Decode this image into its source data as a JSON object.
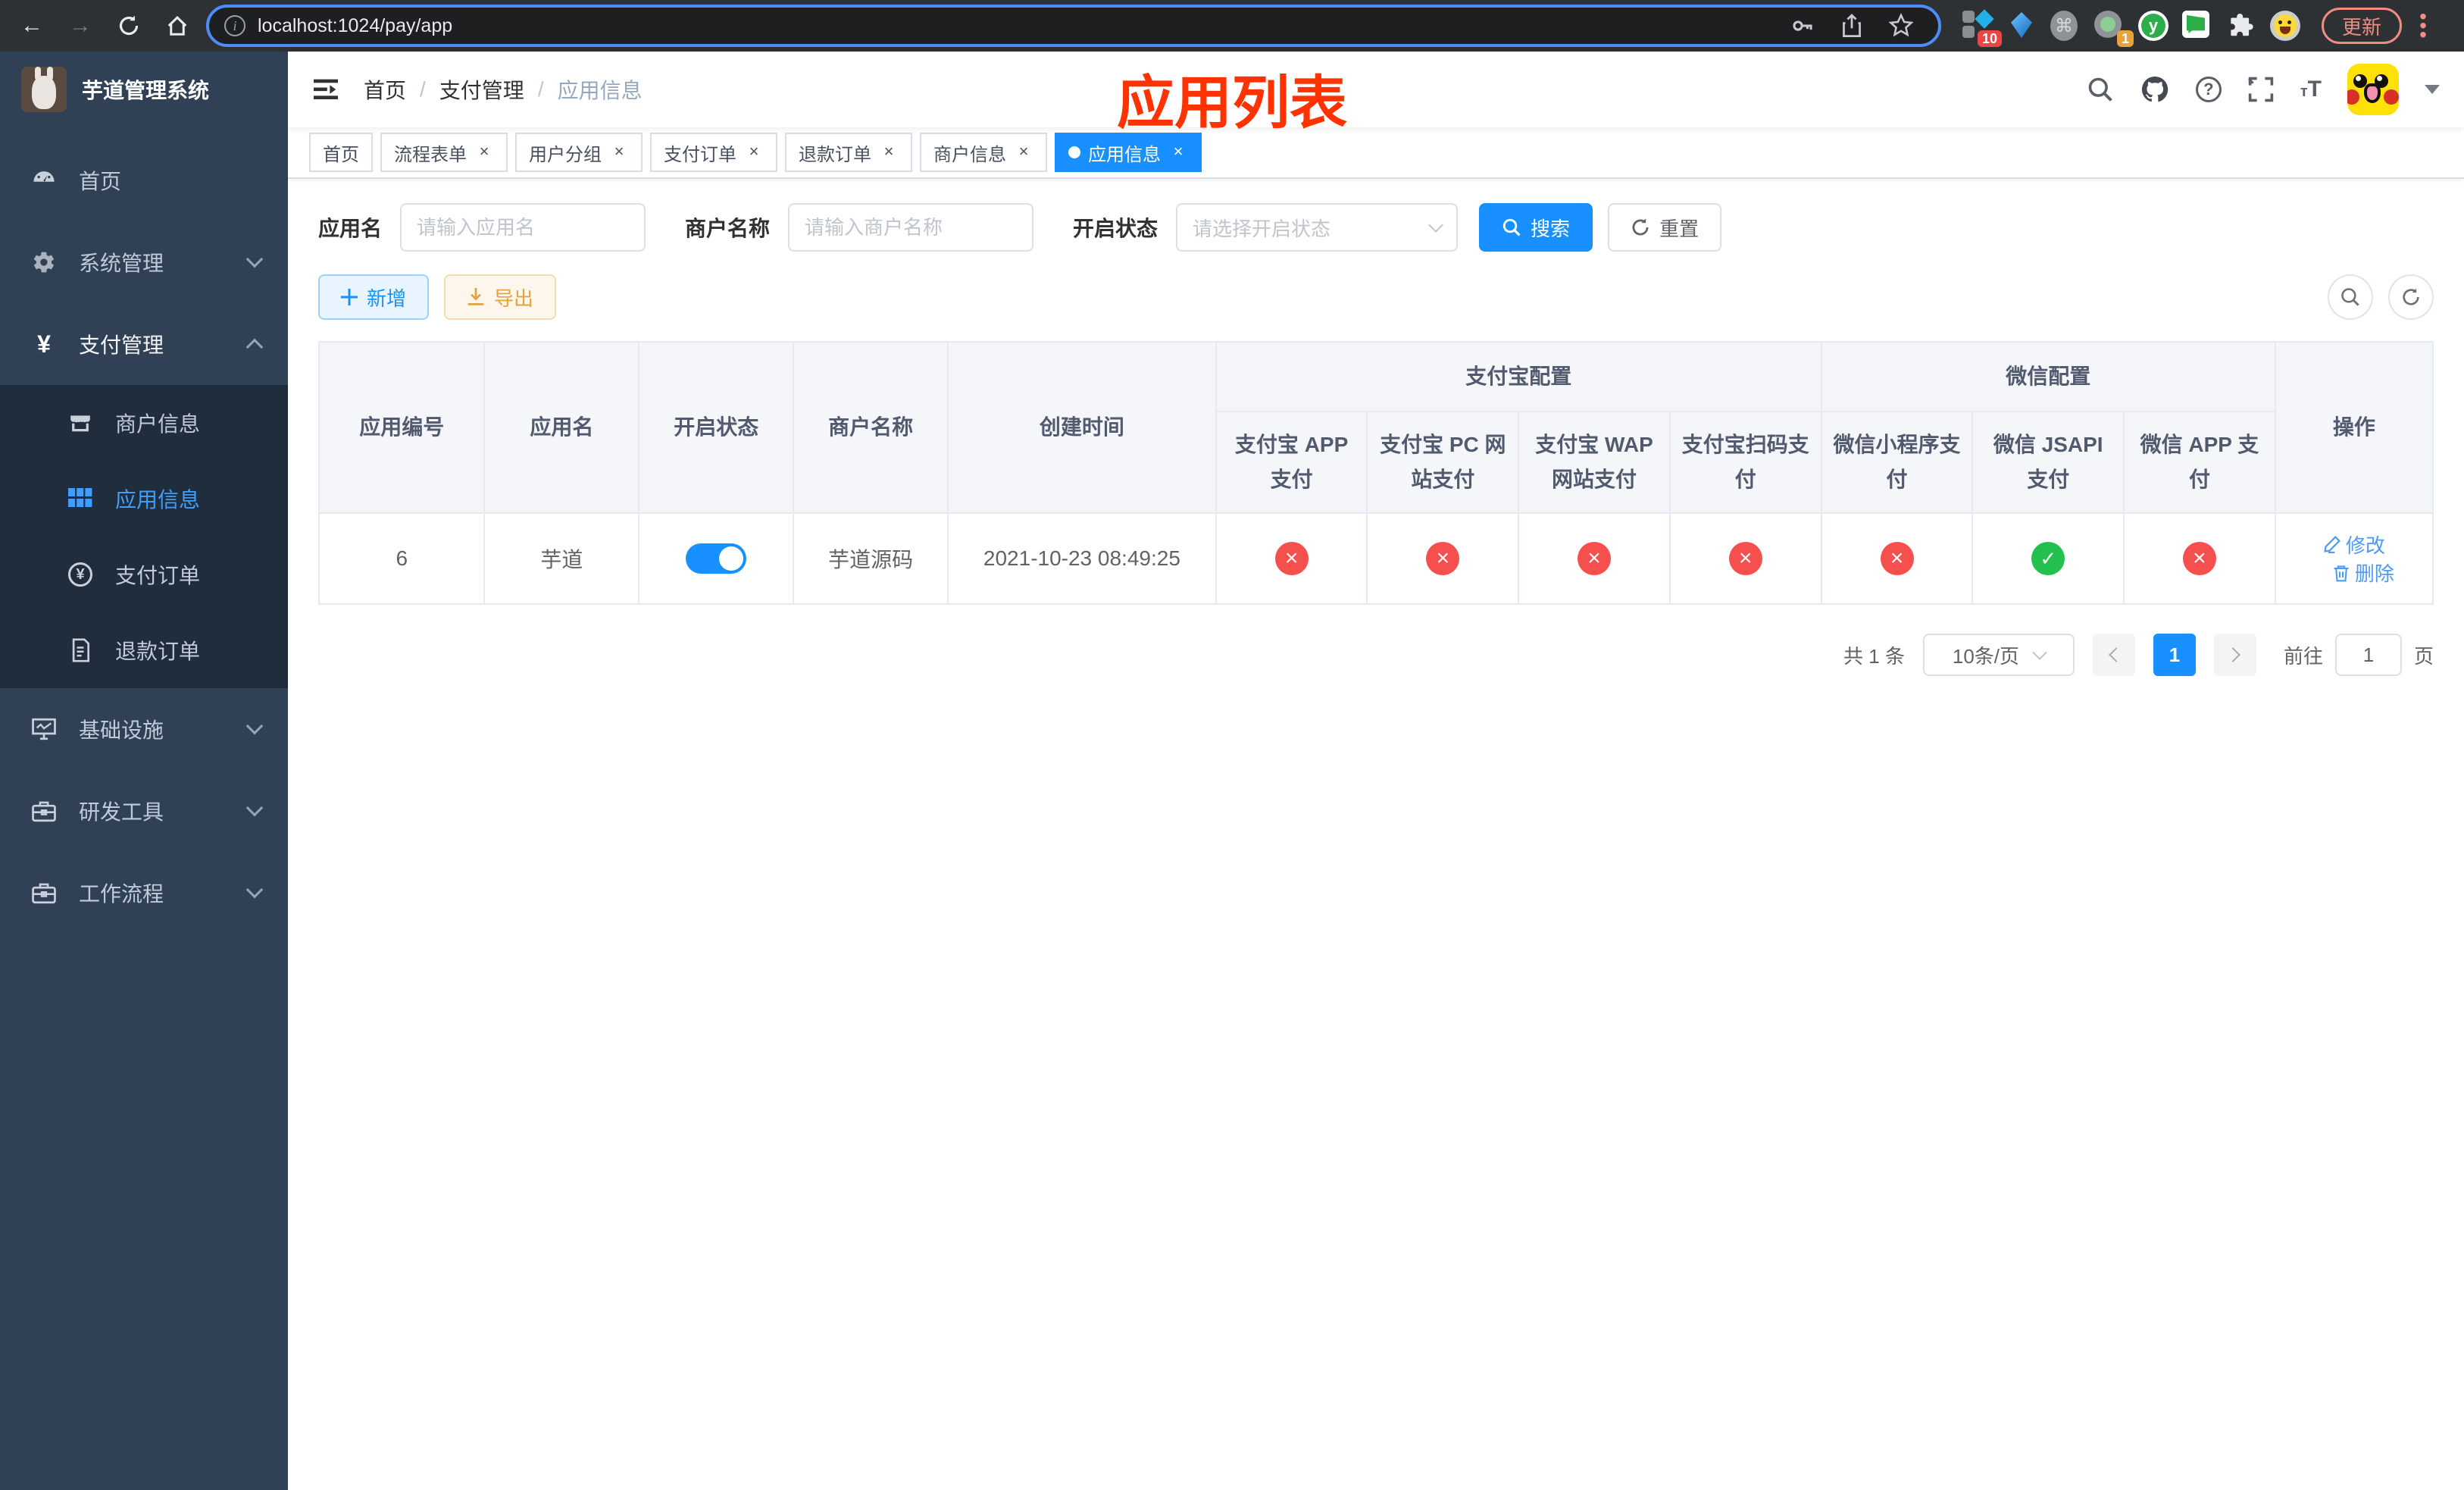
{
  "browser": {
    "url": "localhost:1024/pay/app",
    "update_label": "更新",
    "ext_badge_red": "10",
    "ext_badge_orange": "1",
    "ext_y_label": "y"
  },
  "sidebar": {
    "title": "芋道管理系统",
    "items": [
      {
        "label": "首页"
      },
      {
        "label": "系统管理"
      },
      {
        "label": "支付管理"
      },
      {
        "label": "商户信息"
      },
      {
        "label": "应用信息"
      },
      {
        "label": "支付订单"
      },
      {
        "label": "退款订单"
      },
      {
        "label": "基础设施"
      },
      {
        "label": "研发工具"
      },
      {
        "label": "工作流程"
      }
    ]
  },
  "navbar": {
    "breadcrumb": [
      "首页",
      "支付管理",
      "应用信息"
    ],
    "overlay_title": "应用列表"
  },
  "tabs": [
    {
      "label": "首页"
    },
    {
      "label": "流程表单"
    },
    {
      "label": "用户分组"
    },
    {
      "label": "支付订单"
    },
    {
      "label": "退款订单"
    },
    {
      "label": "商户信息"
    },
    {
      "label": "应用信息"
    }
  ],
  "filters": {
    "app_name_label": "应用名",
    "app_name_placeholder": "请输入应用名",
    "merchant_label": "商户名称",
    "merchant_placeholder": "请输入商户名称",
    "status_label": "开启状态",
    "status_placeholder": "请选择开启状态",
    "search_label": "搜索",
    "reset_label": "重置"
  },
  "toolbar": {
    "add_label": "新增",
    "export_label": "导出"
  },
  "table": {
    "group_alipay": "支付宝配置",
    "group_wechat": "微信配置",
    "columns": [
      "应用编号",
      "应用名",
      "开启状态",
      "商户名称",
      "创建时间",
      "支付宝 APP 支付",
      "支付宝 PC 网站支付",
      "支付宝 WAP 网站支付",
      "支付宝扫码支付",
      "微信小程序支付",
      "微信 JSAPI 支付",
      "微信 APP 支付",
      "操作"
    ],
    "rows": [
      {
        "id": "6",
        "name": "芋道",
        "enabled": true,
        "merchant": "芋道源码",
        "created": "2021-10-23 08:49:25",
        "channels": [
          false,
          false,
          false,
          false,
          false,
          true,
          false
        ],
        "edit_label": "修改",
        "delete_label": "删除"
      }
    ]
  },
  "pagination": {
    "total": "共 1 条",
    "per_page": "10条/页",
    "page": "1",
    "goto_label": "前往",
    "goto_value": "1",
    "goto_suffix": "页"
  },
  "colors": {
    "primary": "#1890ff",
    "sidebar_bg": "#304156",
    "submenu_bg": "#1f2d3d",
    "danger": "#f5504e",
    "success": "#23c050",
    "title_red": "#ff3200"
  }
}
